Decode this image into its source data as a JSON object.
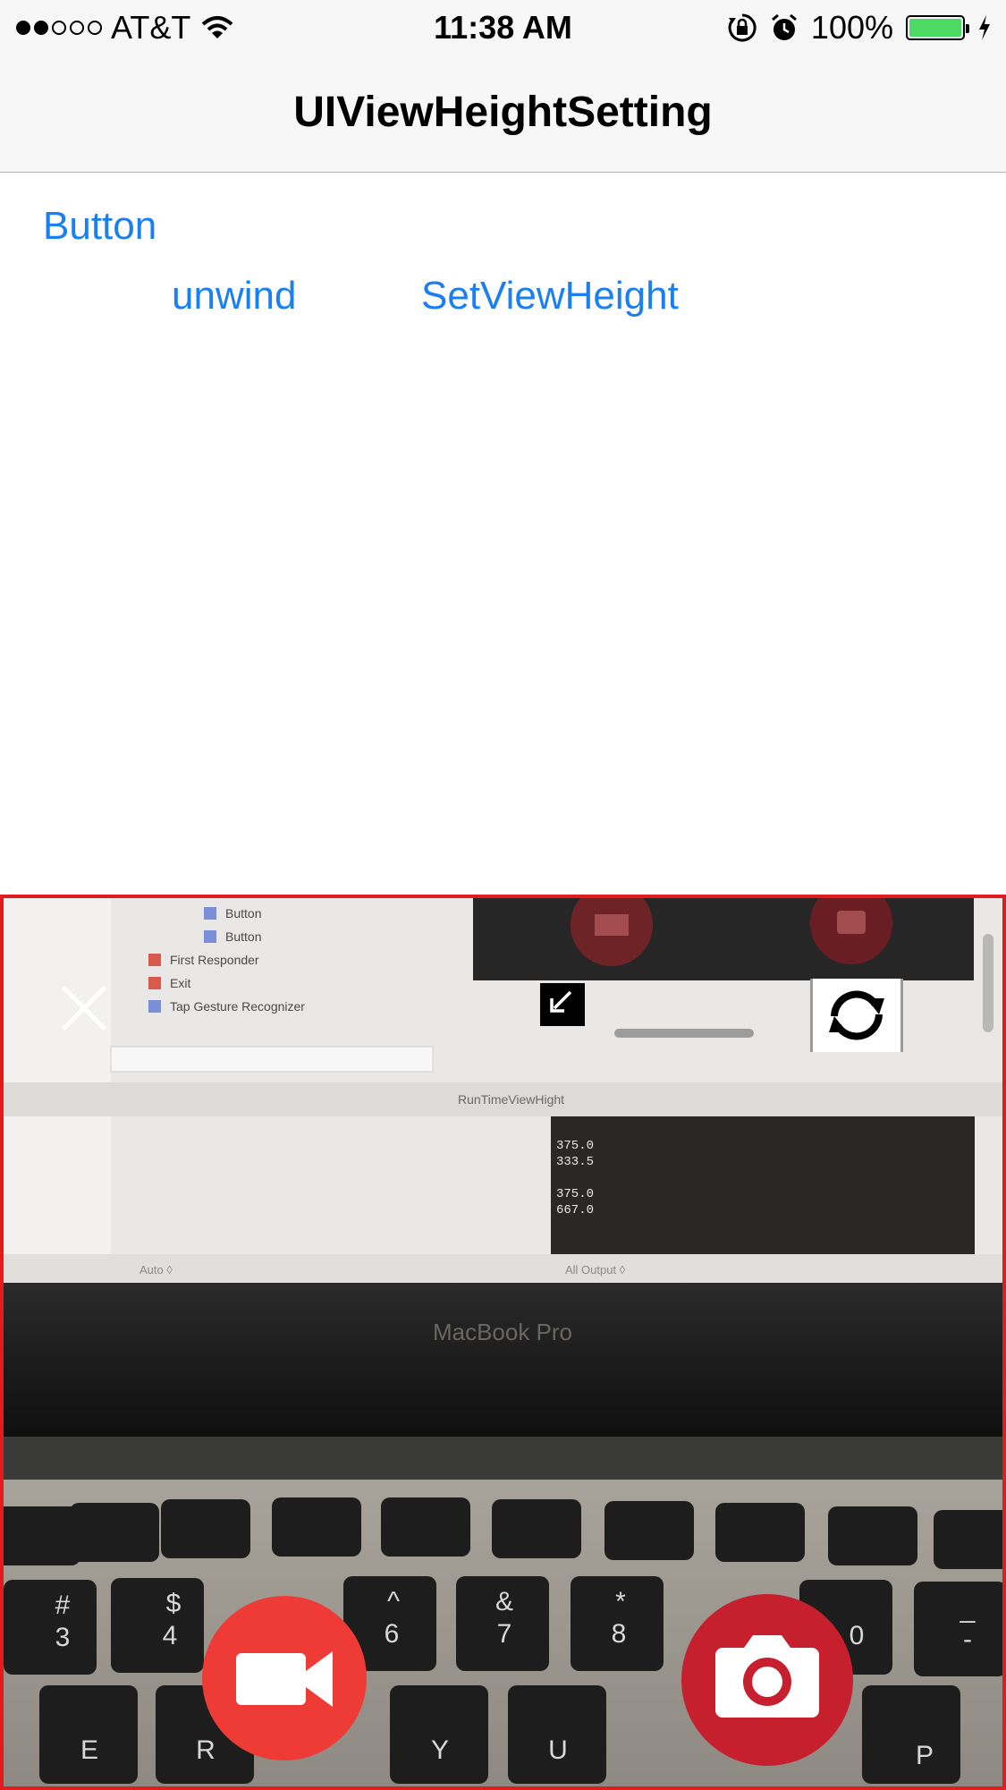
{
  "status_bar": {
    "signal_filled": 2,
    "signal_total": 5,
    "carrier": "AT&T",
    "wifi_icon": "wifi-icon",
    "time": "11:38 AM",
    "orientation_lock_icon": "orientation-lock-icon",
    "alarm_icon": "alarm-icon",
    "battery_percent": "100%",
    "battery_level": 1.0,
    "battery_color": "#4cd964",
    "charging_icon": "bolt-icon"
  },
  "nav": {
    "title": "UIViewHeightSetting"
  },
  "buttons": {
    "button": "Button",
    "unwind": "unwind",
    "set_view_height": "SetViewHeight",
    "color": "#1a7ff0"
  },
  "camera": {
    "border_color": "#e21c1c",
    "close_icon": "close-icon",
    "minimize_icon": "minimize-arrow-icon",
    "flip_icon": "camera-flip-icon",
    "record_icon": "video-camera-icon",
    "record_color": "#ef3b36",
    "photo_icon": "camera-icon",
    "photo_color": "#c6202e",
    "scene": {
      "laptop_label": "MacBook Pro",
      "outline_items": [
        "Button",
        "Button",
        "First Responder",
        "Exit",
        "Tap Gesture Recognizer"
      ],
      "debug_bar_label": "RunTimeViewHight",
      "console_lines": [
        "375.0",
        "333.5",
        "375.0",
        "667.0"
      ],
      "auto_label": "Auto ◊",
      "output_label": "All Output ◊",
      "key_row_top": [
        "#",
        "$",
        "^",
        "&",
        "*",
        "0",
        "_"
      ],
      "key_row_top_sub": [
        "3",
        "4",
        "6",
        "7",
        "8",
        "",
        "-"
      ],
      "key_row_letters": [
        "E",
        "R",
        "Y",
        "U",
        "P"
      ]
    }
  }
}
